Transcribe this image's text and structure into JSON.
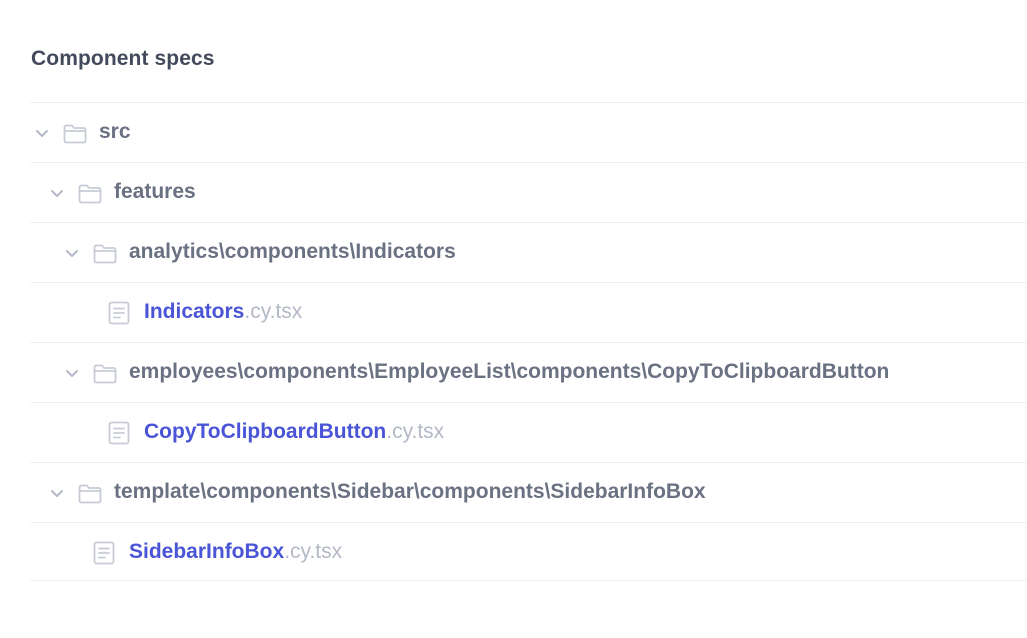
{
  "section": {
    "title": "Component specs"
  },
  "tree": {
    "folders": [
      {
        "label": "src"
      },
      {
        "label": "features"
      },
      {
        "label": "analytics\\components\\Indicators"
      },
      {
        "label": "employees\\components\\EmployeeList\\components\\CopyToClipboardButton"
      },
      {
        "label": "template\\components\\Sidebar\\components\\SidebarInfoBox"
      }
    ],
    "files": [
      {
        "name": "Indicators",
        "ext": ".cy.tsx"
      },
      {
        "name": "CopyToClipboardButton",
        "ext": ".cy.tsx"
      },
      {
        "name": "SidebarInfoBox",
        "ext": ".cy.tsx"
      }
    ]
  },
  "icons": {
    "chevron": "chevron-down-icon",
    "folder": "folder-icon",
    "file": "file-icon"
  },
  "colors": {
    "title": "#434a5c",
    "folder_text": "#6a7182",
    "file_name": "#4955d6",
    "file_ext": "#b3b8c6",
    "icon": "#c7cbd6",
    "divider": "#eef0f4"
  }
}
